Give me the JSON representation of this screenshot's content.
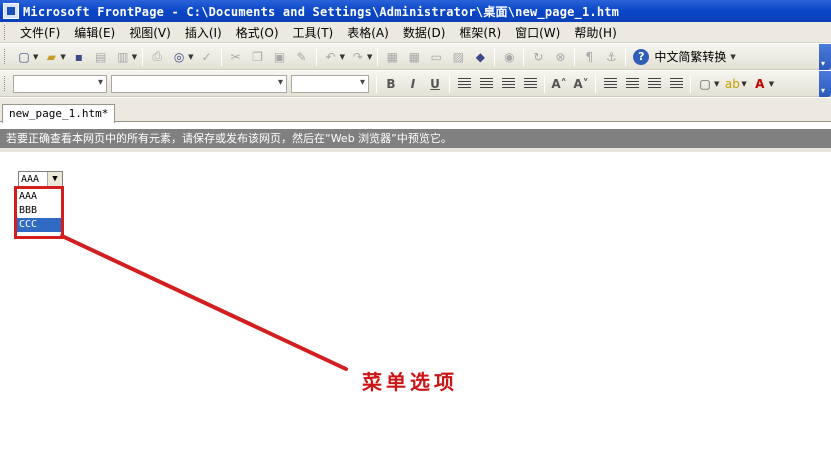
{
  "window": {
    "title": "Microsoft FrontPage - C:\\Documents and Settings\\Administrator\\桌面\\new_page_1.htm"
  },
  "menubar": {
    "items": [
      "文件(F)",
      "编辑(E)",
      "视图(V)",
      "插入(I)",
      "格式(O)",
      "工具(T)",
      "表格(A)",
      "数据(D)",
      "框架(R)",
      "窗口(W)",
      "帮助(H)"
    ]
  },
  "toolbar": {
    "convert_label": "中文简繁转换",
    "buttons": [
      "new-icon",
      "open-icon",
      "save-icon",
      "publish-icon",
      "print-icon",
      "preview-icon",
      "spell-icon",
      "cut-icon",
      "copy-icon",
      "paste-icon",
      "format-painter-icon",
      "undo-icon",
      "redo-icon",
      "insert-component-icon",
      "table-icon",
      "layer-icon",
      "picture-icon",
      "drawing-icon",
      "hyperlink-icon",
      "refresh-icon",
      "stop-icon",
      "bookmark-icon",
      "help-icon"
    ]
  },
  "format_toolbar": {
    "bold": "B",
    "italic": "I",
    "underline": "U"
  },
  "tabs": {
    "active": "new_page_1.htm*"
  },
  "infobar": {
    "text": "若要正确查看本网页中的所有元素，请保存或发布该网页，然后在“Web 浏览器”中预览它。"
  },
  "page": {
    "select_value": "AAA",
    "options": [
      "AAA",
      "BBB",
      "CCC"
    ],
    "selected_option_index": 2
  },
  "annotation": {
    "label": "菜单选项",
    "color": "#cc1414"
  }
}
